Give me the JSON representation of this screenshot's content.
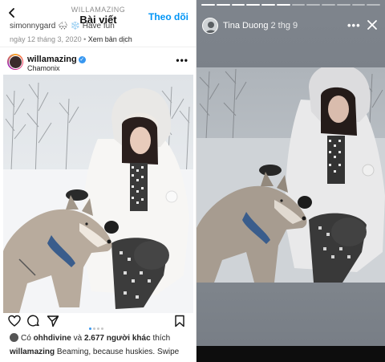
{
  "post": {
    "header_sub": "WILLAMAZING",
    "header_title": "Bài viết",
    "follow_label": "Theo dõi",
    "prev_caption": "simonnygard 🌨 ❄️ Have fun",
    "date": "ngày 12 tháng 3, 2020",
    "translate_label": "Xem bản dịch",
    "username": "willamazing",
    "location": "Chamonix",
    "more_label": "•••",
    "likes_prefix": "Có",
    "likes_user": "ohhdivine",
    "likes_mid": "và",
    "likes_count": "2.677 người khác",
    "likes_suffix": "thích",
    "caption_user": "willamazing",
    "caption_text": "Beaming, because huskies. Swipe",
    "carousel": {
      "total": 4,
      "active": 1
    },
    "icons": [
      "back-icon",
      "verified-icon",
      "heart-icon",
      "comment-icon",
      "share-icon",
      "bookmark-icon"
    ]
  },
  "story": {
    "username": "Tina Duong",
    "time": "2 thg 9",
    "more_label": "•••",
    "progress": {
      "segments": 12,
      "viewed": 6
    },
    "icons": [
      "avatar",
      "close-icon"
    ]
  },
  "colors": {
    "accent": "#0095f6",
    "story_bg": "#7f858c",
    "verified": "#3897f0"
  }
}
